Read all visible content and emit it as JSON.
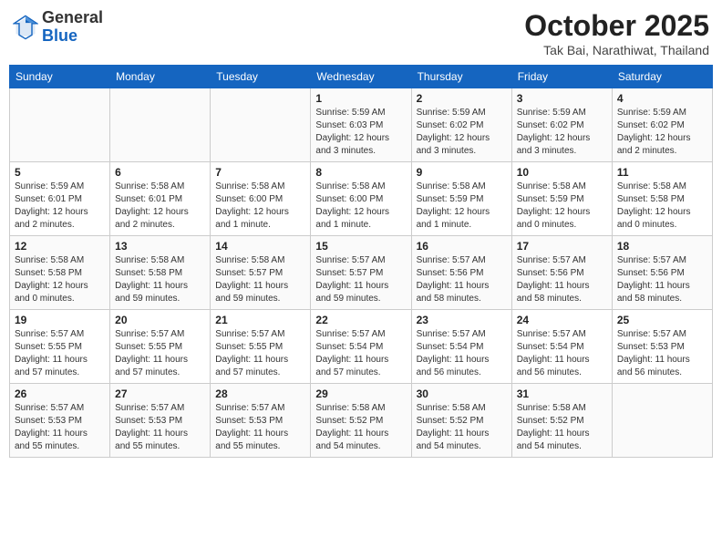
{
  "header": {
    "logo_general": "General",
    "logo_blue": "Blue",
    "month_title": "October 2025",
    "location": "Tak Bai, Narathiwat, Thailand"
  },
  "weekdays": [
    "Sunday",
    "Monday",
    "Tuesday",
    "Wednesday",
    "Thursday",
    "Friday",
    "Saturday"
  ],
  "weeks": [
    [
      {
        "day": "",
        "info": ""
      },
      {
        "day": "",
        "info": ""
      },
      {
        "day": "",
        "info": ""
      },
      {
        "day": "1",
        "info": "Sunrise: 5:59 AM\nSunset: 6:03 PM\nDaylight: 12 hours\nand 3 minutes."
      },
      {
        "day": "2",
        "info": "Sunrise: 5:59 AM\nSunset: 6:02 PM\nDaylight: 12 hours\nand 3 minutes."
      },
      {
        "day": "3",
        "info": "Sunrise: 5:59 AM\nSunset: 6:02 PM\nDaylight: 12 hours\nand 3 minutes."
      },
      {
        "day": "4",
        "info": "Sunrise: 5:59 AM\nSunset: 6:02 PM\nDaylight: 12 hours\nand 2 minutes."
      }
    ],
    [
      {
        "day": "5",
        "info": "Sunrise: 5:59 AM\nSunset: 6:01 PM\nDaylight: 12 hours\nand 2 minutes."
      },
      {
        "day": "6",
        "info": "Sunrise: 5:58 AM\nSunset: 6:01 PM\nDaylight: 12 hours\nand 2 minutes."
      },
      {
        "day": "7",
        "info": "Sunrise: 5:58 AM\nSunset: 6:00 PM\nDaylight: 12 hours\nand 1 minute."
      },
      {
        "day": "8",
        "info": "Sunrise: 5:58 AM\nSunset: 6:00 PM\nDaylight: 12 hours\nand 1 minute."
      },
      {
        "day": "9",
        "info": "Sunrise: 5:58 AM\nSunset: 5:59 PM\nDaylight: 12 hours\nand 1 minute."
      },
      {
        "day": "10",
        "info": "Sunrise: 5:58 AM\nSunset: 5:59 PM\nDaylight: 12 hours\nand 0 minutes."
      },
      {
        "day": "11",
        "info": "Sunrise: 5:58 AM\nSunset: 5:58 PM\nDaylight: 12 hours\nand 0 minutes."
      }
    ],
    [
      {
        "day": "12",
        "info": "Sunrise: 5:58 AM\nSunset: 5:58 PM\nDaylight: 12 hours\nand 0 minutes."
      },
      {
        "day": "13",
        "info": "Sunrise: 5:58 AM\nSunset: 5:58 PM\nDaylight: 11 hours\nand 59 minutes."
      },
      {
        "day": "14",
        "info": "Sunrise: 5:58 AM\nSunset: 5:57 PM\nDaylight: 11 hours\nand 59 minutes."
      },
      {
        "day": "15",
        "info": "Sunrise: 5:57 AM\nSunset: 5:57 PM\nDaylight: 11 hours\nand 59 minutes."
      },
      {
        "day": "16",
        "info": "Sunrise: 5:57 AM\nSunset: 5:56 PM\nDaylight: 11 hours\nand 58 minutes."
      },
      {
        "day": "17",
        "info": "Sunrise: 5:57 AM\nSunset: 5:56 PM\nDaylight: 11 hours\nand 58 minutes."
      },
      {
        "day": "18",
        "info": "Sunrise: 5:57 AM\nSunset: 5:56 PM\nDaylight: 11 hours\nand 58 minutes."
      }
    ],
    [
      {
        "day": "19",
        "info": "Sunrise: 5:57 AM\nSunset: 5:55 PM\nDaylight: 11 hours\nand 57 minutes."
      },
      {
        "day": "20",
        "info": "Sunrise: 5:57 AM\nSunset: 5:55 PM\nDaylight: 11 hours\nand 57 minutes."
      },
      {
        "day": "21",
        "info": "Sunrise: 5:57 AM\nSunset: 5:55 PM\nDaylight: 11 hours\nand 57 minutes."
      },
      {
        "day": "22",
        "info": "Sunrise: 5:57 AM\nSunset: 5:54 PM\nDaylight: 11 hours\nand 57 minutes."
      },
      {
        "day": "23",
        "info": "Sunrise: 5:57 AM\nSunset: 5:54 PM\nDaylight: 11 hours\nand 56 minutes."
      },
      {
        "day": "24",
        "info": "Sunrise: 5:57 AM\nSunset: 5:54 PM\nDaylight: 11 hours\nand 56 minutes."
      },
      {
        "day": "25",
        "info": "Sunrise: 5:57 AM\nSunset: 5:53 PM\nDaylight: 11 hours\nand 56 minutes."
      }
    ],
    [
      {
        "day": "26",
        "info": "Sunrise: 5:57 AM\nSunset: 5:53 PM\nDaylight: 11 hours\nand 55 minutes."
      },
      {
        "day": "27",
        "info": "Sunrise: 5:57 AM\nSunset: 5:53 PM\nDaylight: 11 hours\nand 55 minutes."
      },
      {
        "day": "28",
        "info": "Sunrise: 5:57 AM\nSunset: 5:53 PM\nDaylight: 11 hours\nand 55 minutes."
      },
      {
        "day": "29",
        "info": "Sunrise: 5:58 AM\nSunset: 5:52 PM\nDaylight: 11 hours\nand 54 minutes."
      },
      {
        "day": "30",
        "info": "Sunrise: 5:58 AM\nSunset: 5:52 PM\nDaylight: 11 hours\nand 54 minutes."
      },
      {
        "day": "31",
        "info": "Sunrise: 5:58 AM\nSunset: 5:52 PM\nDaylight: 11 hours\nand 54 minutes."
      },
      {
        "day": "",
        "info": ""
      }
    ]
  ]
}
